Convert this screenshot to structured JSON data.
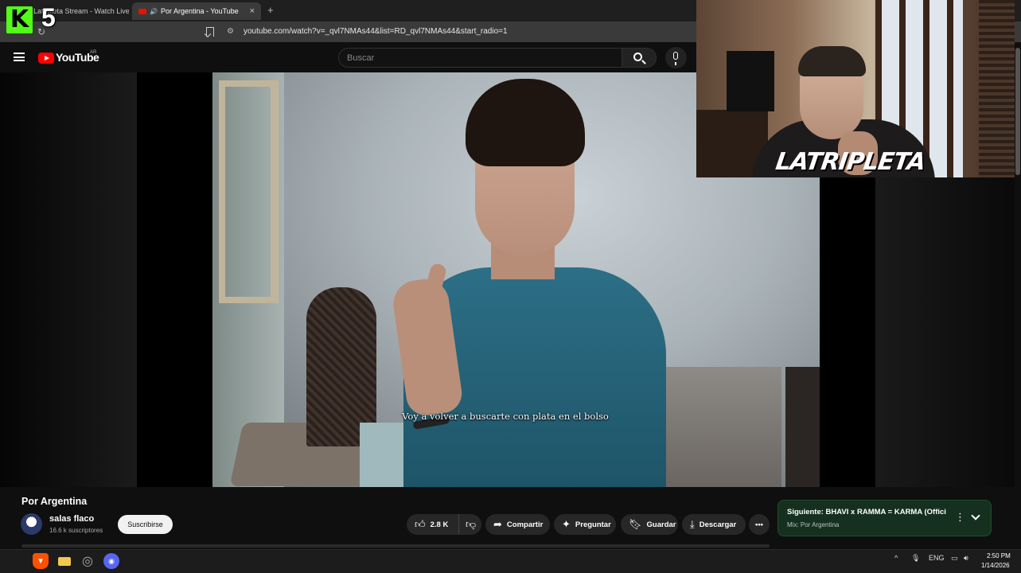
{
  "browser": {
    "tabs": [
      {
        "label": "Latripleta Stream - Watch Live o",
        "active": false
      },
      {
        "label": "Por Argentina - YouTube",
        "active": true
      }
    ],
    "url": "youtube.com/watch?v=_qvl7NMAs44&list=RD_qvl7NMAs44&start_radio=1"
  },
  "overlay": {
    "kick_number": "5",
    "kick_letter": "K",
    "webcam_logo": "LATRIPLETA"
  },
  "youtube": {
    "logo_text": "YouTube",
    "region": "AR",
    "search_placeholder": "Buscar"
  },
  "video": {
    "subtitle": "Voy a volver a buscarte con plata en el bolso",
    "title": "Por Argentina",
    "channel": "salas flaco",
    "subscribers": "16.6 k suscriptores",
    "subscribe_label": "Suscribirse"
  },
  "actions": {
    "likes": "2.8 K",
    "share": "Compartir",
    "ask": "Preguntar",
    "save": "Guardar",
    "download": "Descargar"
  },
  "up_next": {
    "title": "Siguiente: BHAVI x RAMMA = KARMA (Offici...",
    "subtitle": "Mix: Por Argentina"
  },
  "taskbar": {
    "language": "ENG",
    "time": "2:50 PM",
    "date": "1/14/2026"
  },
  "colors": {
    "youtube_red": "#ff0000",
    "kick_green": "#53fc18",
    "up_next_bg": "#16301f"
  }
}
